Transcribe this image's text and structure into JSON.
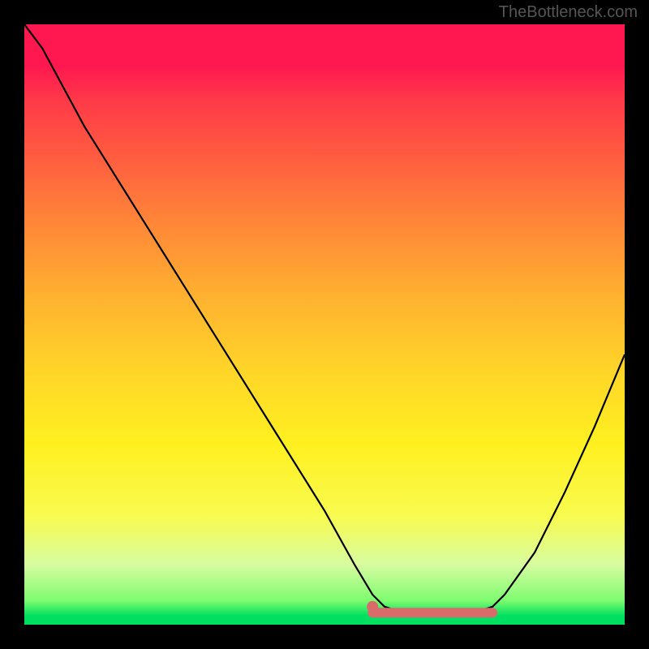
{
  "watermark": "TheBottleneck.com",
  "chart_data": {
    "type": "line",
    "title": "",
    "xlabel": "",
    "ylabel": "",
    "xlim": [
      0,
      100
    ],
    "ylim": [
      0,
      100
    ],
    "series": [
      {
        "name": "bottleneck-curve",
        "x": [
          0,
          3,
          10,
          20,
          30,
          40,
          50,
          55,
          58,
          60,
          63,
          70,
          75,
          78,
          80,
          85,
          90,
          95,
          100
        ],
        "values": [
          100,
          96,
          83,
          67,
          51,
          35,
          19,
          10,
          5,
          3,
          2,
          2,
          2,
          3,
          5,
          12,
          22,
          33,
          45
        ]
      }
    ],
    "highlight_segment": {
      "name": "optimal-zone",
      "x_start": 58,
      "x_end": 78,
      "y": 2
    },
    "highlight_dot": {
      "x": 58,
      "y": 3
    },
    "gradient_background": {
      "top_color": "#ff1850",
      "mid_color": "#ffd628",
      "bottom_color": "#00e060"
    }
  }
}
